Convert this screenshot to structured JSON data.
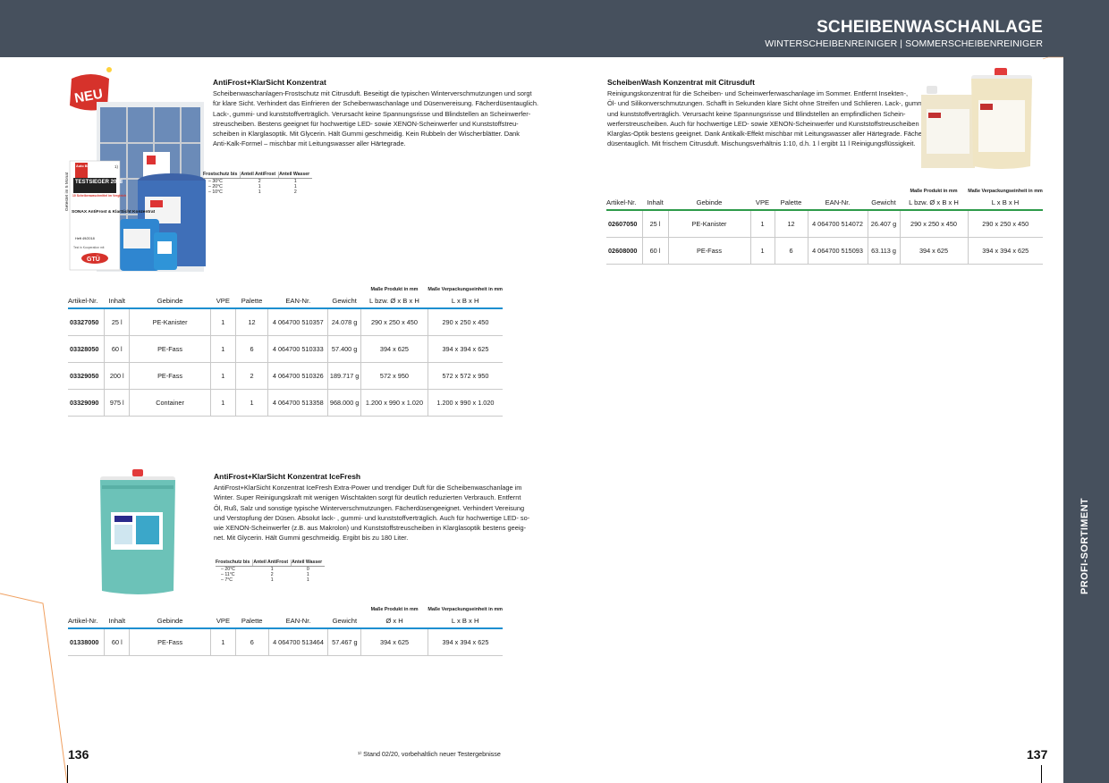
{
  "header": {
    "title": "SCHEIBENWASCHANLAGE",
    "subtitle": "WINTERSCHEIBENREINIGER | SOMMERSCHEIBENREINIGER"
  },
  "sidebar_label": "PROFI-SORTIMENT",
  "page_left": "136",
  "page_right": "137",
  "footnote": "¹⁾ Stand 02/20, vorbehaltlich neuer Testergebnisse",
  "badges": {
    "neu": "NEU",
    "test_side": "Getestet im 5 Monat",
    "test_brand": "Auto Bild",
    "test_title": "TESTSIEGER 2018",
    "test_small": "10 Scheibenwaschmittel im Vergleich",
    "test_product": "SONAX AntiFrost & KlarSicht Konzentrat",
    "test_issue": "Heft 49/2018",
    "test_coop": "Test in Kooperation mit",
    "test_org": "GTÜ",
    "test_mark": "1)"
  },
  "col_headers": {
    "artikel": "Artikel-Nr.",
    "inhalt": "Inhalt",
    "gebinde": "Gebinde",
    "vpe": "VPE",
    "palette": "Palette",
    "ean": "EAN-Nr.",
    "gewicht": "Gewicht",
    "masse_produkt": "Maße Produkt in mm",
    "masse_vpe": "Maße Verpackungseinheit in mm",
    "lbxh": "L bzw. Ø x B x H",
    "lxbxh": "L x B x H",
    "oxh": "Ø x H"
  },
  "frost_headers": {
    "a": "Frostschutz bis",
    "b": "Anteil AntiFrost",
    "c": "Anteil Wasser"
  },
  "product1": {
    "title": "AntiFrost+KlarSicht Konzentrat",
    "lines": [
      "Scheibenwaschanlagen-Frostschutz mit Citrusduft. Beseitigt die typischen Winterverschmutzungen und sorgt",
      "für klare Sicht. Verhindert das Einfrieren der Scheibenwaschanlage und Düsenvereisung. Fächerdüsentauglich.",
      "Lack-, gummi- und kunststoffverträglich. Verursacht keine Spannungsrisse und Blindstellen an Scheinwerfer-",
      "streuscheiben. Bestens geeignet für hochwertige LED- sowie XENON-Scheinwerfer und Kunststoffstreu-",
      "scheiben in Klarglasoptik. Mit Glycerin. Hält Gummi geschmeidig. Kein Rubbeln der Wischerblätter. Dank",
      "Anti-Kalk-Formel – mischbar mit Leitungswasser aller Härtegrade."
    ],
    "frost": [
      [
        "– 30°C",
        "2",
        "1"
      ],
      [
        "– 20°C",
        "1",
        "1"
      ],
      [
        "– 10°C",
        "1",
        "2"
      ]
    ],
    "rows": [
      [
        "03327050",
        "25 l",
        "PE-Kanister",
        "1",
        "12",
        "4 064700 510357",
        "24.078 g",
        "290 x 250 x 450",
        "290 x 250 x 450"
      ],
      [
        "03328050",
        "60 l",
        "PE-Fass",
        "1",
        "6",
        "4 064700 510333",
        "57.400 g",
        "394 x 625",
        "394 x 394 x 625"
      ],
      [
        "03329050",
        "200 l",
        "PE-Fass",
        "1",
        "2",
        "4 064700 510326",
        "189.717 g",
        "572 x 950",
        "572 x 572 x 950"
      ],
      [
        "03329090",
        "975 l",
        "Container",
        "1",
        "1",
        "4 064700 513358",
        "968.000 g",
        "1.200 x 990 x 1.020",
        "1.200 x 990 x 1.020"
      ]
    ]
  },
  "product2": {
    "title": "AntiFrost+KlarSicht Konzentrat IceFresh",
    "lines": [
      "AntiFrost+KlarSicht Konzentrat IceFresh Extra-Power und trendiger Duft für die Scheibenwaschanlage im",
      "Winter. Super Reinigungskraft mit wenigen Wischtakten sorgt für deutlich reduzierten Verbrauch. Entfernt",
      "Öl, Ruß, Salz und sonstige typische Winterverschmutzungen. Fächerdüsengeeignet. Verhindert Vereisung",
      "und Verstopfung der Düsen. Absolut lack- , gummi- und kunststoffverträglich. Auch für hochwertige LED- so-",
      "wie XENON-Scheinwerfer (z.B. aus Makrolon) und Kunststoffstreuscheiben in Klarglasoptik bestens geeig-",
      "net. Mit Glycerin. Hält Gummi geschmeidig. Ergibt bis zu 180 Liter."
    ],
    "frost": [
      [
        "– 20°C",
        "1",
        "0"
      ],
      [
        "– 11°C",
        "2",
        "1"
      ],
      [
        "– 7°C",
        "1",
        "1"
      ]
    ],
    "rows": [
      [
        "01338000",
        "60 l",
        "PE-Fass",
        "1",
        "6",
        "4 064700 513464",
        "57.467 g",
        "394 x 625",
        "394 x 394 x 625"
      ]
    ]
  },
  "product3": {
    "title": "ScheibenWash Konzentrat mit Citrusduft",
    "lines": [
      "Reinigungskonzentrat für die Scheiben- und Scheinwerferwaschanlage im Sommer. Entfernt Insekten-,",
      "Öl- und Silikonverschmutzungen. Schafft in Sekunden klare Sicht ohne Streifen und Schlieren. Lack-, gummi-",
      "und kunststoffverträglich. Verursacht keine Spannungsrisse und Blindstellen an empfindlichen Schein-",
      "werferstreuscheiben. Auch für hochwertige LED- sowie XENON-Scheinwerfer und Kunststoffstreuscheiben in",
      "Klarglas-Optik bestens geeignet. Dank Antikalk-Effekt mischbar mit Leitungswasser aller Härtegrade. Fächer-",
      "düsentauglich. Mit frischem Citrusduft. Mischungsverhältnis 1:10, d.h. 1 l ergibt 11 l Reinigungsflüssigkeit."
    ],
    "rows": [
      [
        "02607050",
        "25 l",
        "PE-Kanister",
        "1",
        "12",
        "4 064700 514072",
        "26.407 g",
        "290 x 250 x 450",
        "290 x 250 x 450"
      ],
      [
        "02608000",
        "60 l",
        "PE-Fass",
        "1",
        "6",
        "4 064700 515093",
        "63.113 g",
        "394 x 625",
        "394 x 394 x 625"
      ]
    ]
  }
}
